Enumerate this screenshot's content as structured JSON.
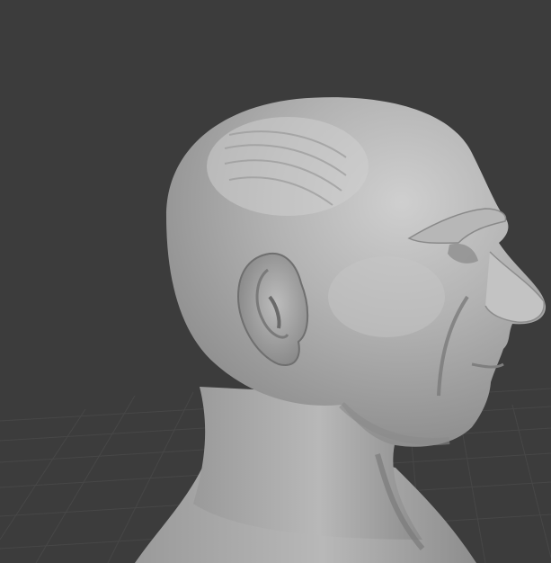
{
  "viewport": {
    "background_color": "#3c3c3c",
    "grid_color": "#4a4a4a",
    "grid_fine_color": "#434343",
    "model_color": "#a9a9a9",
    "model_highlight_color": "#c9c9c9",
    "model_shadow_color": "#7e7e7e"
  }
}
